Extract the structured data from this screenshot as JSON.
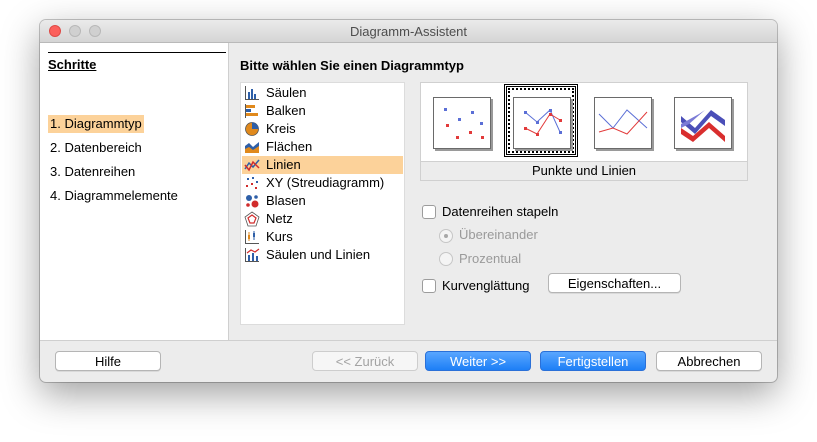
{
  "window": {
    "title": "Diagramm-Assistent"
  },
  "steps": {
    "title": "Schritte",
    "items": [
      {
        "label": "1. Diagrammtyp",
        "active": true
      },
      {
        "label": "2. Datenbereich",
        "active": false
      },
      {
        "label": "3. Datenreihen",
        "active": false
      },
      {
        "label": "4. Diagrammelemente",
        "active": false
      }
    ]
  },
  "main": {
    "title": "Bitte wählen Sie einen Diagrammtyp",
    "chart_types": [
      {
        "label": "Säulen",
        "icon": "column-chart-icon"
      },
      {
        "label": "Balken",
        "icon": "bar-chart-icon"
      },
      {
        "label": "Kreis",
        "icon": "pie-chart-icon"
      },
      {
        "label": "Flächen",
        "icon": "area-chart-icon"
      },
      {
        "label": "Linien",
        "icon": "line-chart-icon",
        "selected": true
      },
      {
        "label": "XY (Streudiagramm)",
        "icon": "scatter-chart-icon"
      },
      {
        "label": "Blasen",
        "icon": "bubble-chart-icon"
      },
      {
        "label": "Netz",
        "icon": "net-chart-icon"
      },
      {
        "label": "Kurs",
        "icon": "stock-chart-icon"
      },
      {
        "label": "Säulen und Linien",
        "icon": "column-line-chart-icon"
      }
    ],
    "variant_selected_name": "Punkte und Linien",
    "variants": [
      "points-only-icon",
      "points-and-lines-icon",
      "lines-only-icon",
      "3d-lines-icon"
    ],
    "options": {
      "stack_label": "Datenreihen stapeln",
      "stack_checked": false,
      "radio_overlap": "Übereinander",
      "radio_percent": "Prozentual",
      "smooth_label": "Kurvenglättung",
      "smooth_checked": false,
      "properties_button": "Eigenschaften..."
    }
  },
  "footer": {
    "help": "Hilfe",
    "back": "<< Zurück",
    "next": "Weiter >>",
    "finish": "Fertigstellen",
    "cancel": "Abbrechen"
  },
  "colors": {
    "selection": "#fcd29a",
    "default_button": "#1d7ff6",
    "close_button": "#fc605c"
  }
}
